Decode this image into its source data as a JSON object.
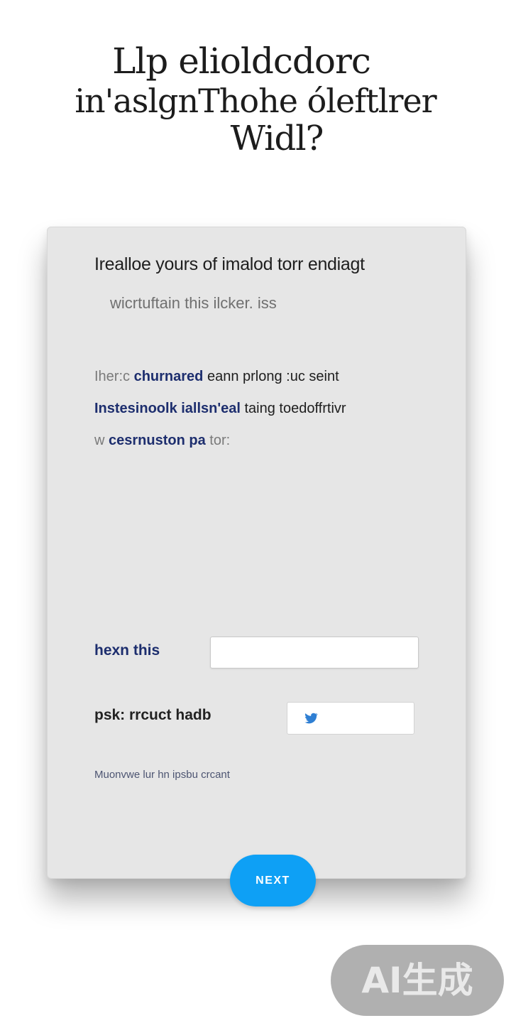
{
  "title": {
    "line1": "Llp elioldcdorc",
    "line2": "in'aslgnThohe óleftlrer",
    "line3": "Widl?"
  },
  "card": {
    "heading": "Irealloe yours of imalod torr endiagt",
    "subheading": "wicrtuftain this ilcker. iss",
    "body": {
      "line1_a": "Iher:c",
      "line1_b": "churnared",
      "line1_c": "eann prlong :uc seint",
      "line2_a": "Instesinoolk iallsn'eal",
      "line2_b": "taing toedoffrtivr",
      "line3_a": "w",
      "line3_b": "cesrnuston pa",
      "line3_c": "tor:"
    },
    "field1_label": "hexn this",
    "field2_label": "psk: rrcuct hadb",
    "note": "Muonvwe lur hn ipsbu crcant"
  },
  "next_button_label": "NEXT",
  "watermark": "AI生成",
  "colors": {
    "accent": "#0ea0f5",
    "label_blue": "#1d2e6e",
    "card_bg": "#e6e6e6"
  },
  "icons": {
    "small_input_icon": "twitter-bird-icon"
  }
}
